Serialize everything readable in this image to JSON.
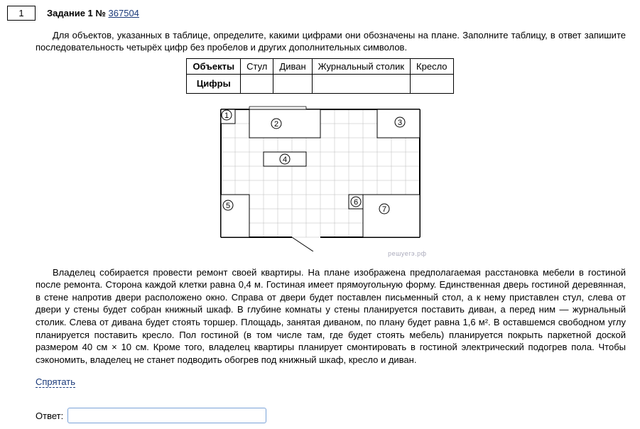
{
  "task": {
    "number": "1",
    "label": "Задание 1",
    "id_prefix": "№",
    "id": "367504"
  },
  "intro": {
    "p1": "Для объектов, указанных в таблице, определите, какими цифрами они обозначены на плане. Заполните таблицу, в ответ запишите последовательность четырёх цифр без пробелов и других дополнительных символов."
  },
  "table": {
    "row1label": "Объекты",
    "row2label": "Цифры",
    "headers": [
      "Стул",
      "Диван",
      "Журнальный столик",
      "Кресло"
    ],
    "values": [
      "",
      "",
      "",
      ""
    ]
  },
  "plan": {
    "labels": {
      "1": "1",
      "2": "2",
      "3": "3",
      "4": "4",
      "5": "5",
      "6": "6",
      "7": "7"
    },
    "watermark": "решуегэ.рф"
  },
  "description": {
    "text": "Владелец собирается провести ремонт своей квартиры. На плане изображена предполагаемая расстановка мебели в гостиной после ремонта. Сторона каждой клетки равна 0,4 м. Гостиная имеет прямоугольную форму. Единственная дверь гостиной деревянная, в стене напротив двери расположено окно. Справа от двери будет поставлен письменный стол, а к нему приставлен стул, слева от двери у стены будет собран книжный шкаф. В глубине комнаты у стены планируется поставить диван, а перед ним — журнальный столик. Слева от дивана будет стоять торшер. Площадь, занятая диваном, по плану будет равна 1,6 м². В оставшемся свободном углу планируется поставить кресло. Пол гостиной (в том числе там, где будет стоять мебель) планируется покрыть паркетной доской размером 40 см × 10 см. Кроме того, владелец квартиры планирует смонтировать в гостиной электрический подогрев пола. Чтобы сэкономить, владелец не станет подводить обогрев под книжный шкаф, кресло и диван."
  },
  "buttons": {
    "hide": "Спрятать"
  },
  "answer": {
    "label": "Ответ:",
    "value": ""
  }
}
